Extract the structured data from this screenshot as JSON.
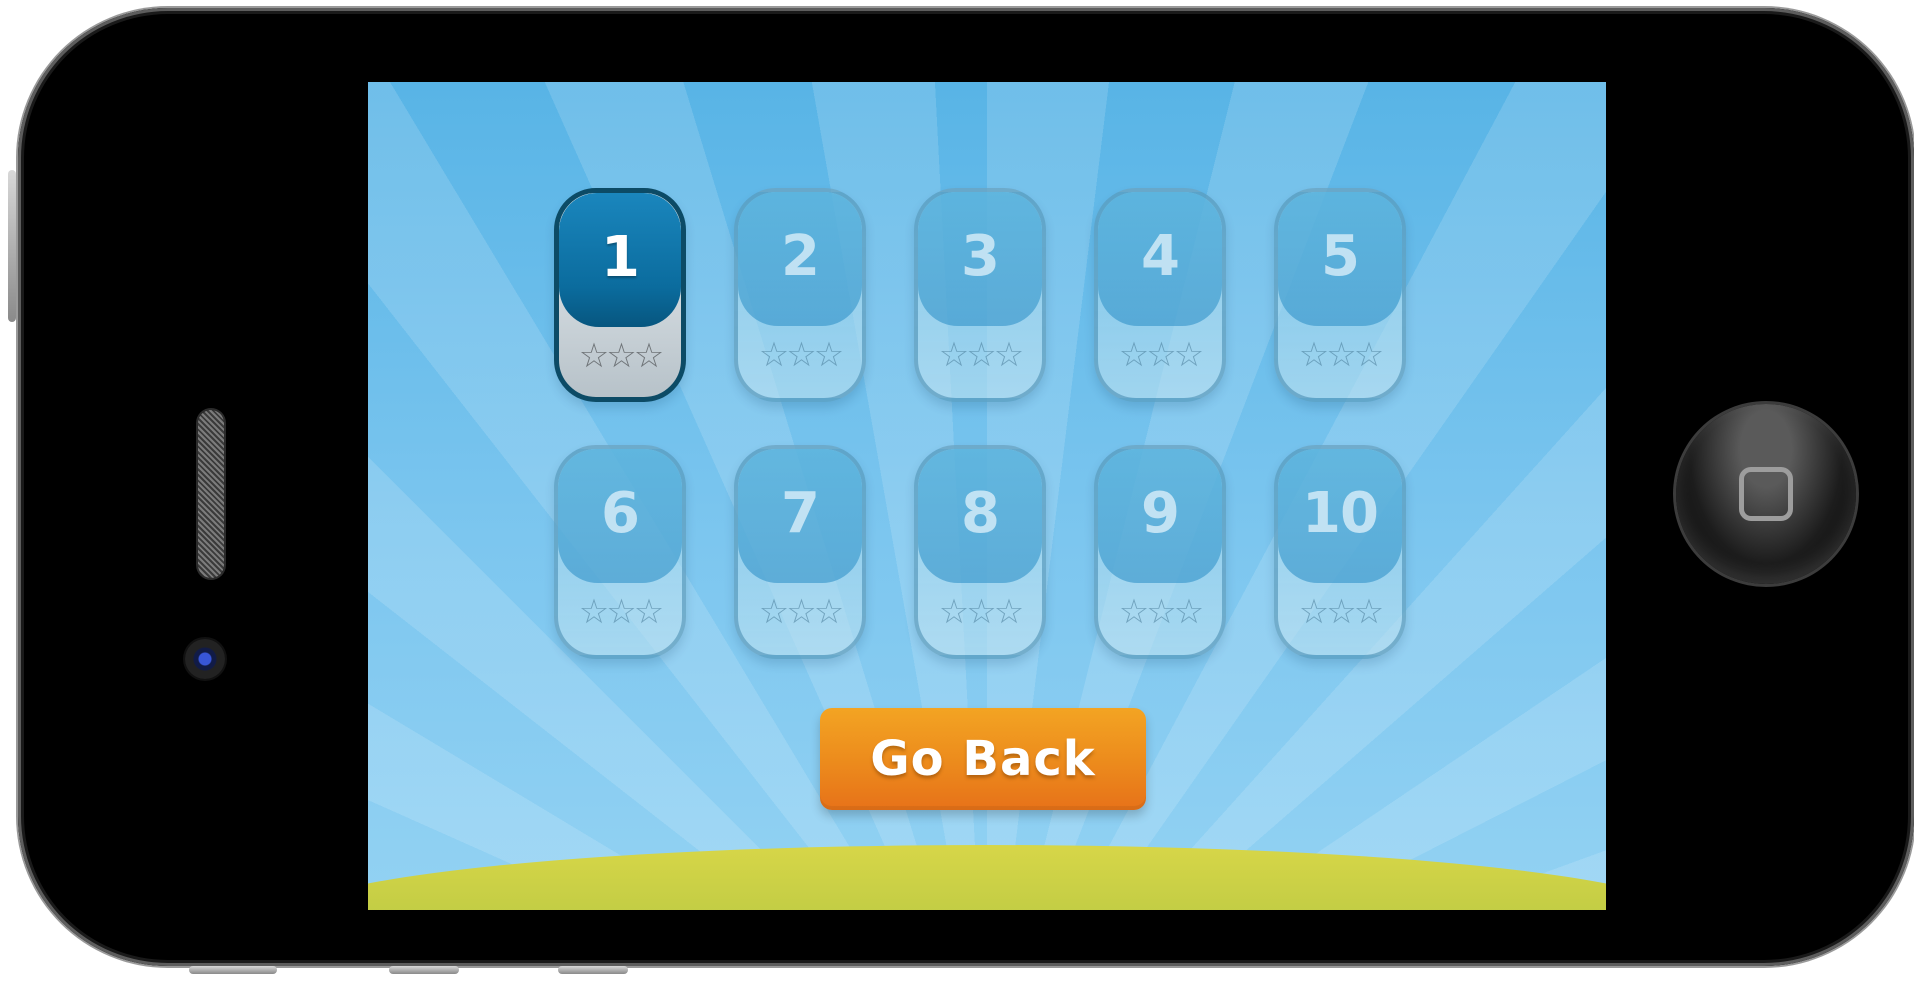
{
  "levels": [
    {
      "number": "1",
      "stars": "☆☆☆",
      "unlocked": true
    },
    {
      "number": "2",
      "stars": "☆☆☆",
      "unlocked": false
    },
    {
      "number": "3",
      "stars": "☆☆☆",
      "unlocked": false
    },
    {
      "number": "4",
      "stars": "☆☆☆",
      "unlocked": false
    },
    {
      "number": "5",
      "stars": "☆☆☆",
      "unlocked": false
    },
    {
      "number": "6",
      "stars": "☆☆☆",
      "unlocked": false
    },
    {
      "number": "7",
      "stars": "☆☆☆",
      "unlocked": false
    },
    {
      "number": "8",
      "stars": "☆☆☆",
      "unlocked": false
    },
    {
      "number": "9",
      "stars": "☆☆☆",
      "unlocked": false
    },
    {
      "number": "10",
      "stars": "☆☆☆",
      "unlocked": false
    }
  ],
  "buttons": {
    "go_back": "Go Back"
  },
  "colors": {
    "sky": "#6ebfec",
    "grass": "#c7d146",
    "button": "#ec8a1c",
    "unlocked_level": "#0b6c9e"
  },
  "icons": {
    "home": "home-button-icon",
    "star": "star-outline-icon"
  }
}
